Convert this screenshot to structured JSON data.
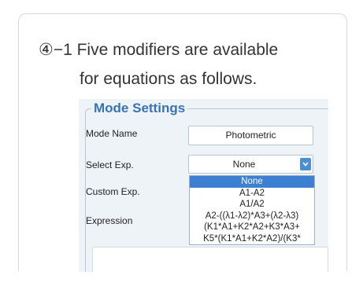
{
  "instruction": {
    "line1": "④−1 Five modifiers are available",
    "line2": "for equations as follows."
  },
  "mode_settings": {
    "title": "Mode Settings",
    "mode_name_label": "Mode Name",
    "mode_name_value": "Photometric",
    "select_exp_label": "Select Exp.",
    "select_exp_value": "None",
    "custom_exp_label": "Custom Exp.",
    "expression_label": "Expression",
    "options": [
      "None",
      "A1-A2",
      "A1/A2",
      "A2-((λ1-λ2)*A3+(λ2-λ3)",
      "(K1*A1+K2*A2+K3*A3+",
      "K5*(K1*A1+K2*A2)/(K3*"
    ]
  },
  "icons": {
    "dropdown": "chevron-down-icon"
  },
  "colors": {
    "title_blue": "#3a73b0",
    "selected_option": "#3d7fd0",
    "button_blue": "#4a8fd6"
  }
}
